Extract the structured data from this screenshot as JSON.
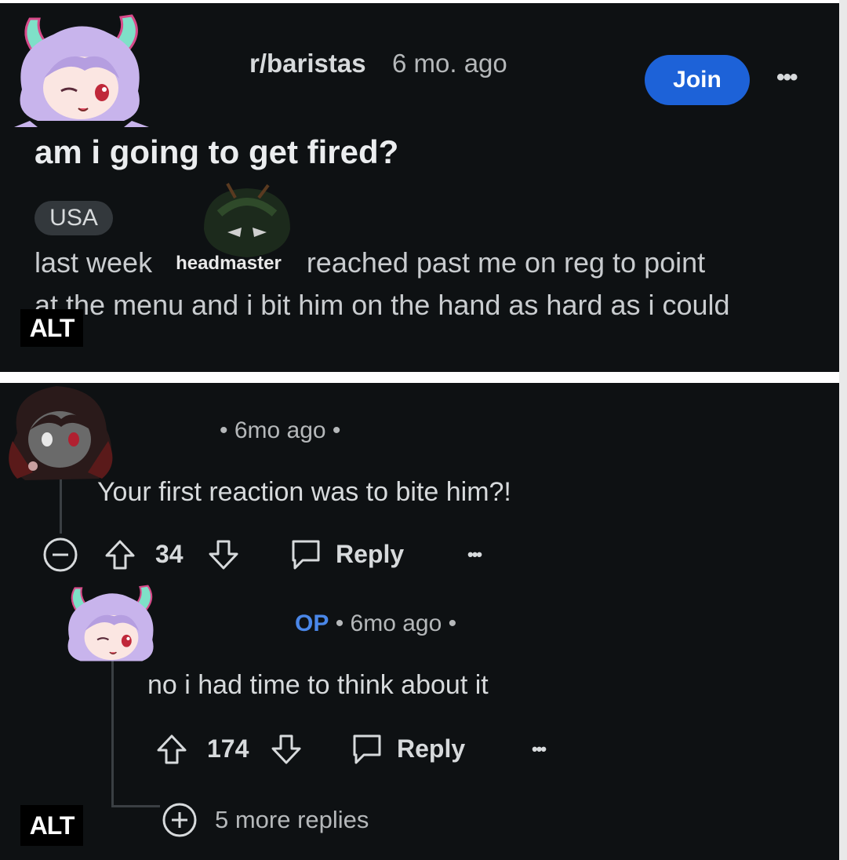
{
  "post": {
    "subreddit": "r/baristas",
    "age": "6 mo. ago",
    "join_label": "Join",
    "more_label": "•••",
    "title": "am i going to get fired?",
    "flair": "USA",
    "body_line1_start": "last week",
    "body_name": "headmaster",
    "body_line1_end": "reached past me on reg to point",
    "body_line2": "at the menu and i bit him on the hand as hard as i could",
    "alt_label": "ALT"
  },
  "comment1": {
    "meta": "• 6mo ago •",
    "text": "Your first reaction was to bite him?!",
    "score": "34",
    "reply_label": "Reply",
    "more_label": "•••"
  },
  "comment2": {
    "op_label": "OP",
    "meta": "• 6mo ago •",
    "text": "no i had time to think about it",
    "score": "174",
    "reply_label": "Reply",
    "more_label": "•••"
  },
  "more_replies": "5 more replies",
  "alt_label": "ALT",
  "colors": {
    "background": "#0e1113",
    "join_button": "#1d62d8",
    "op_label": "#4a87e8",
    "text": "#d7dadc"
  },
  "icons": [
    "collapse-icon",
    "upvote-icon",
    "downvote-icon",
    "reply-icon",
    "more-icon",
    "plus-circle-icon"
  ]
}
